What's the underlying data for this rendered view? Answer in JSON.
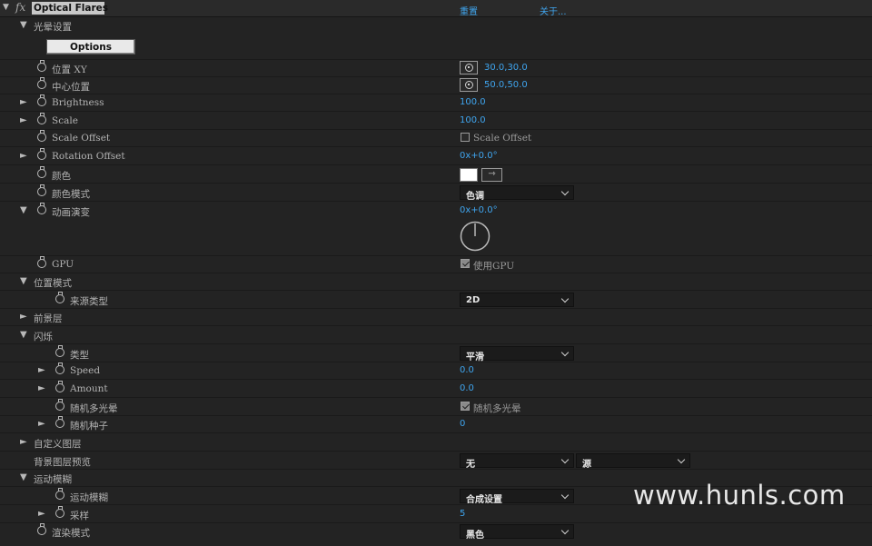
{
  "header": {
    "effect_name": "Optical Flares",
    "reset_link": "重置",
    "about_link": "关于..."
  },
  "options_button": "Options",
  "watermark": "www.hunls.com",
  "rows": {
    "section_halo": "光晕设置",
    "position_xy": {
      "label": "位置 XY",
      "value": "30.0,30.0"
    },
    "center_pos": {
      "label": "中心位置",
      "value": "50.0,50.0"
    },
    "brightness": {
      "label": "Brightness",
      "value": "100.0"
    },
    "scale": {
      "label": "Scale",
      "value": "100.0"
    },
    "scale_offset": {
      "label": "Scale Offset",
      "checkbox_label": "Scale Offset",
      "checked": false
    },
    "rotation_offset": {
      "label": "Rotation Offset",
      "value": "0x+0.0°"
    },
    "color": {
      "label": "颜色",
      "swatch": "#ffffff"
    },
    "color_mode": {
      "label": "颜色模式",
      "value": "色调"
    },
    "animation": {
      "label": "动画演变",
      "value": "0x+0.0°"
    },
    "gpu": {
      "label": "GPU",
      "checkbox_label": "使用GPU",
      "checked": true
    },
    "section_position_mode": "位置模式",
    "source_type": {
      "label": "来源类型",
      "value": "2D"
    },
    "section_foreground": "前景层",
    "section_flicker": "闪烁",
    "flicker_type": {
      "label": "类型",
      "value": "平滑"
    },
    "speed": {
      "label": "Speed",
      "value": "0.0"
    },
    "amount": {
      "label": "Amount",
      "value": "0.0"
    },
    "random_flares": {
      "label": "随机多光晕",
      "checkbox_label": "随机多光晕",
      "checked": true
    },
    "random_seed": {
      "label": "随机种子",
      "value": "0"
    },
    "section_custom_layer": "自定义图层",
    "bg_preview": {
      "label": "背景图层预览",
      "value1": "无",
      "value2": "源"
    },
    "section_motion_blur": "运动模糊",
    "motion_blur": {
      "label": "运动模糊",
      "value": "合成设置"
    },
    "samples": {
      "label": "采样",
      "value": "5"
    },
    "render_mode": {
      "label": "渲染模式",
      "value": "黑色"
    }
  }
}
